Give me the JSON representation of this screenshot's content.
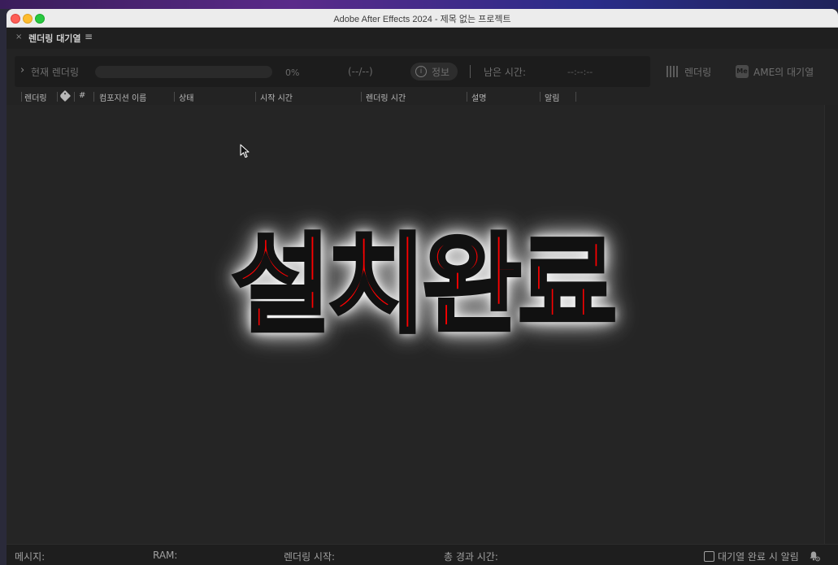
{
  "window": {
    "title": "Adobe After Effects 2024 - 제목 없는 프로젝트"
  },
  "panel": {
    "tab_close": "×",
    "tab_label": "렌더링 대기열",
    "tab_menu": "≡"
  },
  "render_bar": {
    "chevron": "›",
    "current_label": "현재 렌더링",
    "progress_percent": 0,
    "percent_text": "0%",
    "frames_text": "(--/--)",
    "info_icon": "i",
    "info_label": "정보",
    "remaining_label": "남은 시간:",
    "remaining_value": "--:--:--"
  },
  "buttons": {
    "render_label": "렌더링",
    "ame_icon_text": "Me",
    "ame_label": "AME의 대기열"
  },
  "columns": {
    "render": "렌더링",
    "tag_icon": "tag-icon",
    "number": "#",
    "comp_name": "컴포지션 이름",
    "status": "상태",
    "start_time": "시작 시간",
    "render_time": "렌더링 시간",
    "comment": "설명",
    "notify": "알림"
  },
  "overlay": {
    "text": "설치완료",
    "color": "#ff0000"
  },
  "statusbar": {
    "message_label": "메시지:",
    "ram_label": "RAM:",
    "render_start_label": "렌더링 시작:",
    "elapsed_label": "총 경과 시간:",
    "notify_checkbox_label": "대기열 완료 시 알림",
    "notify_checked": false
  }
}
